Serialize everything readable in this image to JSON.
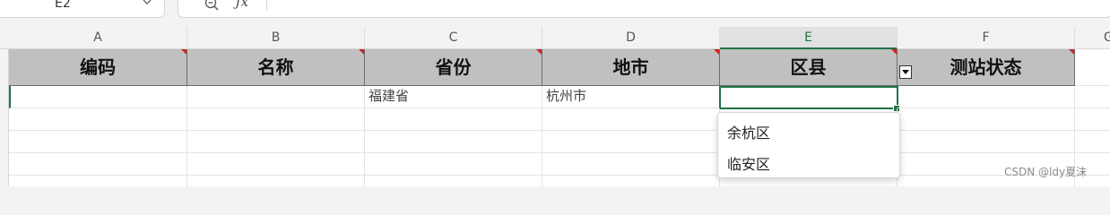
{
  "formula_bar": {
    "name_box": "E2",
    "fx_label": "ƒx"
  },
  "columns": [
    "A",
    "B",
    "C",
    "D",
    "E",
    "F",
    "G"
  ],
  "selected_column": "E",
  "header_row": [
    "编码",
    "名称",
    "省份",
    "地市",
    "区县",
    "测站状态"
  ],
  "data_row": [
    "",
    "",
    "福建省",
    "杭州市",
    "",
    ""
  ],
  "dropdown": {
    "options": [
      "余杭区",
      "临安区"
    ]
  },
  "watermark": "CSDN @ldy夏沫",
  "colors": {
    "accent": "#217346",
    "header_fill": "#c0c0c0",
    "comment_marker": "#d42020"
  }
}
